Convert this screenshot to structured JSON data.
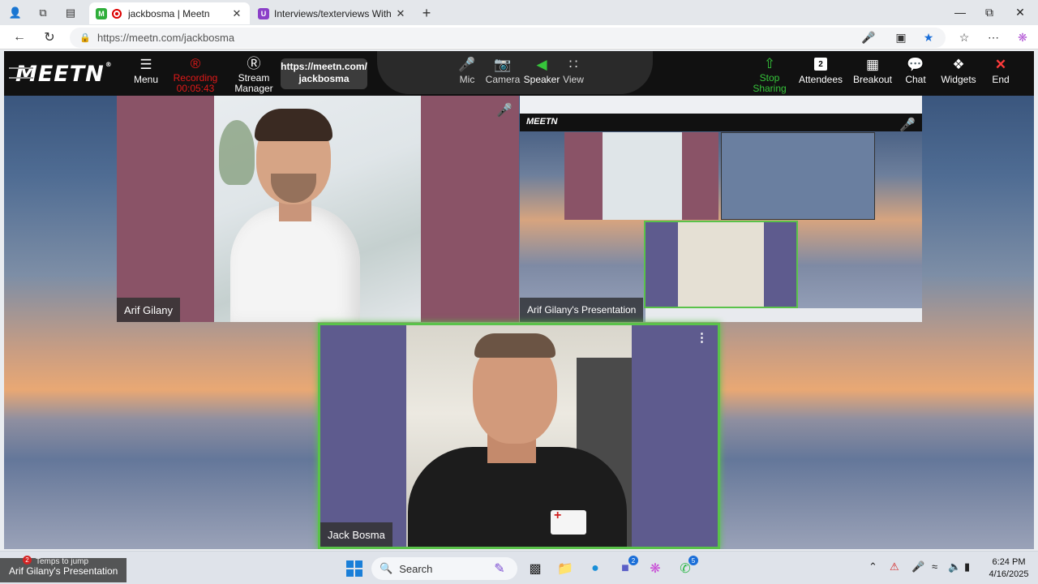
{
  "browser": {
    "tabs": [
      {
        "title": "jackbosma | Meetn",
        "active": true
      },
      {
        "title": "Interviews/texterviews With Jack",
        "active": false
      }
    ],
    "new_tab": "+",
    "address": "https://meetn.com/jackbosma"
  },
  "toolbar": {
    "logo": "MEETN",
    "menu_label": "Menu",
    "recording_label": "Recording",
    "recording_time": "00:05:43",
    "stream_label": "Stream Manager",
    "url_line1": "https://meetn.com/",
    "url_line2": "jackbosma",
    "mic_label": "Mic",
    "camera_label": "Camera",
    "speaker_label": "Speaker",
    "view_label": "View",
    "stop_sharing_label": "Stop Sharing",
    "attendee_count": "2",
    "attendees_label": "Attendees",
    "breakout_label": "Breakout",
    "chat_label": "Chat",
    "widgets_label": "Widgets",
    "end_label": "End"
  },
  "tiles": {
    "arif_name": "Arif Gilany",
    "presentation_name": "Arif Gilany's Presentation",
    "jack_name": "Jack Bosma"
  },
  "taskbar": {
    "search_label": "Search",
    "preview_title": "Arif Gilany's Presentation",
    "preview_sub": "Temps to jump",
    "preview_notif": "2",
    "teams_badge": "2",
    "whatsapp_badge": "5",
    "time": "6:24 PM",
    "date": "4/16/2025"
  },
  "colors": {
    "recording_red": "#e01919",
    "active_speaker_green": "#5ac24a",
    "tile_mauve": "#8a5367",
    "tile_purple": "#5e5b8e"
  }
}
